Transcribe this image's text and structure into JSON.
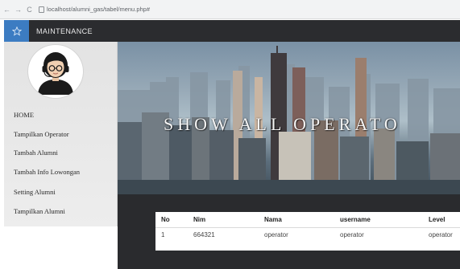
{
  "browser": {
    "url": "localhost/alumni_gas/tabel/menu.php#",
    "back_glyph": "←",
    "forward_glyph": "→",
    "reload_glyph": "C"
  },
  "app": {
    "title": "MAINTENANCE",
    "accent_color": "#3c7cc2"
  },
  "sidebar": {
    "items": [
      {
        "label": "HOME"
      },
      {
        "label": "Tampilkan Operator"
      },
      {
        "label": "Tambah Alumni"
      },
      {
        "label": "Tambah Info Lowongan"
      },
      {
        "label": "Setting Alumni"
      },
      {
        "label": "Tampilkan Alumni"
      }
    ]
  },
  "banner": {
    "title": "SHOW ALL OPERATO"
  },
  "table": {
    "headers": [
      "No",
      "Nim",
      "Nama",
      "username",
      "Level"
    ],
    "rows": [
      [
        "1",
        "664321",
        "operator",
        "operator",
        "operator"
      ]
    ]
  }
}
